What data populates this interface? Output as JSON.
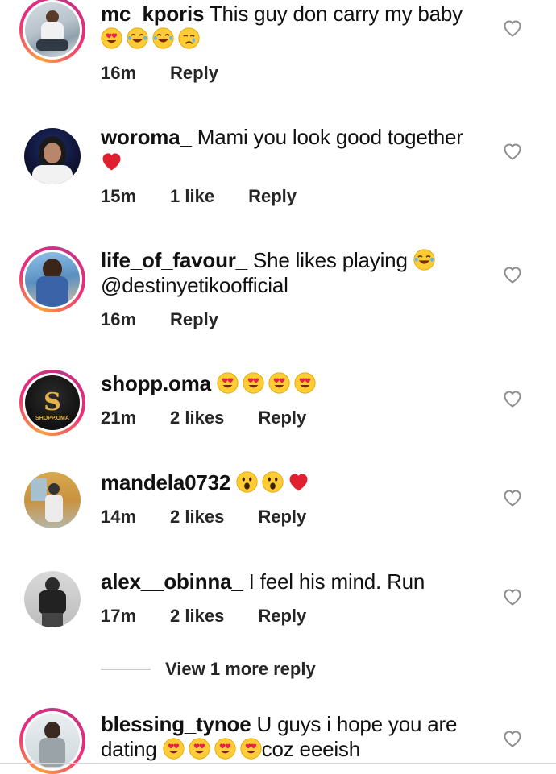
{
  "comments": [
    {
      "username": "mc_kporis",
      "text_line1": "This guy don carry my baby",
      "text_line2": "",
      "emojis": [
        "heart-eyes",
        "tears-of-joy",
        "tears-of-joy",
        "crying"
      ],
      "time": "16m",
      "likes": "",
      "reply": "Reply",
      "has_story": true
    },
    {
      "username": "woroma_",
      "text_line1": "Mami you look good together",
      "emojis": [
        "red-heart"
      ],
      "time": "15m",
      "likes": "1 like",
      "reply": "Reply",
      "has_story": false
    },
    {
      "username": "life_of_favour_",
      "text_line1": "She likes playing",
      "text_line2": "@destinyetikoofficial",
      "emojis": [
        "tears-of-joy"
      ],
      "time": "16m",
      "likes": "",
      "reply": "Reply",
      "has_story": true
    },
    {
      "username": "shopp.oma",
      "emojis": [
        "heart-eyes",
        "heart-eyes",
        "heart-eyes",
        "heart-eyes"
      ],
      "time": "21m",
      "likes": "2 likes",
      "reply": "Reply",
      "avatar_text": "SHOPP.OMA",
      "has_story": true
    },
    {
      "username": "mandela0732",
      "emojis": [
        "astonished",
        "astonished",
        "red-heart"
      ],
      "time": "14m",
      "likes": "2 likes",
      "reply": "Reply",
      "has_story": false
    },
    {
      "username": "alex__obinna_",
      "text_line1": "I feel his mind. Run",
      "time": "17m",
      "likes": "2 likes",
      "reply": "Reply",
      "has_story": false
    },
    {
      "username": "blessing_tynoe",
      "text_line1": "U guys i hope you are",
      "text_line2_prefix": "dating",
      "text_line2_suffix": "coz eeeish",
      "emojis": [
        "heart-eyes",
        "heart-eyes",
        "heart-eyes",
        "heart-eyes"
      ],
      "has_story": true
    }
  ],
  "view_more_replies": "View 1 more reply",
  "icons": {
    "like": "heart-outline-icon"
  },
  "colors": {
    "story_ring_start": "#f9a03f",
    "story_ring_end": "#c13584",
    "heart": "#e0202e",
    "emoji_face": "#ffcc33"
  }
}
